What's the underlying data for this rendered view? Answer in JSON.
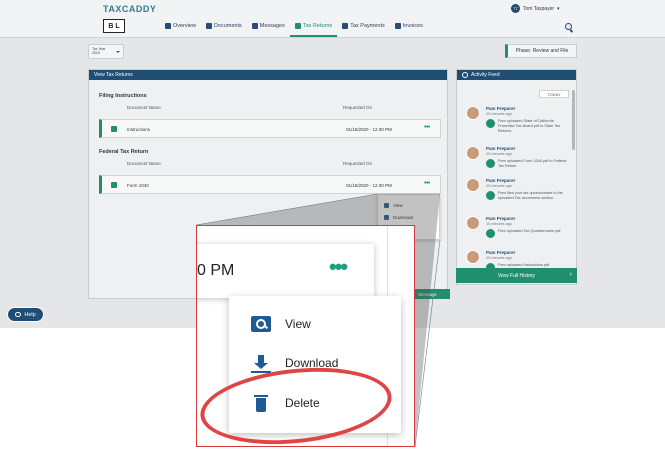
{
  "app": {
    "brand": "TAXCADDY",
    "client_logo": "B L",
    "user_initials": "TT",
    "user_name": "Tom Taxpayer"
  },
  "nav": [
    {
      "label": "Overview",
      "icon": "home-icon"
    },
    {
      "label": "Documents",
      "icon": "documents-icon"
    },
    {
      "label": "Messages",
      "icon": "messages-icon"
    },
    {
      "label": "Tax Returns",
      "icon": "tax-returns-icon",
      "active": true
    },
    {
      "label": "Tax Payments",
      "icon": "dollar-icon"
    },
    {
      "label": "Invoices",
      "icon": "invoice-icon"
    }
  ],
  "toolbar": {
    "year_label": "Tax Year",
    "year_value": "2019",
    "phase_button": "Phase: Review and File"
  },
  "main": {
    "panel_title": "View Tax Returns",
    "filing_section": "Filing Instructions",
    "federal_section": "Federal Tax Return",
    "col_document": "Document Name",
    "col_requested": "Requested On",
    "rows": [
      {
        "name": "Instructions",
        "date": "01/15/2020 - 12:30 PM"
      },
      {
        "name": "Form 1040",
        "date": "01/15/2020 - 12:30 PM"
      }
    ],
    "more_label": "•••",
    "mini_menu": [
      "View",
      "Download"
    ],
    "message_button": "Message"
  },
  "activity": {
    "title": "Activity Feed",
    "today": "TODAY",
    "items": [
      {
        "name": "Pam Preparer",
        "time": "10 minutes ago",
        "text": "Pam uploaded State of California Franchise Tax Board.pdf to State Tax Returns"
      },
      {
        "name": "Pam Preparer",
        "time": "10 minutes ago",
        "text": "Pam uploaded Form 1040.pdf to Federal Tax Return"
      },
      {
        "name": "Pam Preparer",
        "time": "10 minutes ago",
        "text": "Pam filed your tax questionnaire to the uploaded Tax documents section."
      },
      {
        "name": "Pam Preparer",
        "time": "10 minutes ago",
        "text": "Pam uploaded Tax Questionnaire.pdf"
      },
      {
        "name": "Pam Preparer",
        "time": "10 minutes ago",
        "text": "Pam uploaded Instructions.pdf"
      }
    ],
    "view_history": "View Full History",
    "chevron": "›"
  },
  "help": {
    "label": "Help"
  },
  "zoom": {
    "time_fragment": "0 PM",
    "dots": "•••",
    "menu": [
      {
        "label": "View",
        "icon": "view-icon"
      },
      {
        "label": "Download",
        "icon": "download-icon"
      },
      {
        "label": "Delete",
        "icon": "delete-icon"
      }
    ],
    "highlight_color": "#e04545"
  }
}
